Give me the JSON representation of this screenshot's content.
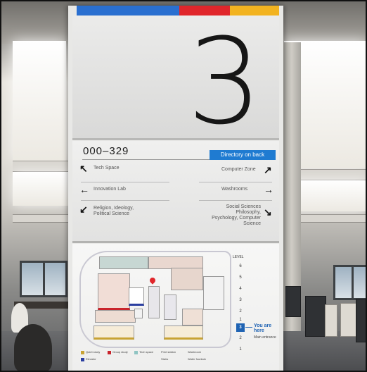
{
  "scene": {
    "description_colors": {
      "blue": "#2a6fd0",
      "red": "#e0262b",
      "yellow": "#f2b320"
    }
  },
  "sign": {
    "floor_number": "3",
    "room_range": "000–329",
    "directory_label": "Directory on back",
    "directions": [
      {
        "arrow": "↖",
        "side": "left",
        "label": "Tech Space"
      },
      {
        "arrow": "↗",
        "side": "right",
        "label": "Computer Zone"
      },
      {
        "arrow": "←",
        "side": "left",
        "label": "Innovation Lab"
      },
      {
        "arrow": "→",
        "side": "right",
        "label": "Washrooms"
      },
      {
        "arrow": "↙",
        "side": "left",
        "label": "Religion, Ideology, Political Science"
      },
      {
        "arrow": "↘",
        "side": "right",
        "label": "Social Sciences Philosophy, Psychology, Computer Science"
      }
    ],
    "map": {
      "level_title": "LEVEL",
      "levels": [
        "6",
        "5",
        "4",
        "3",
        "2",
        "1",
        "3",
        "2",
        "1"
      ],
      "current_level": "3",
      "you_are_here": "You are here",
      "main_entrance": "Main entrance",
      "legend": [
        {
          "color": "#c8a334",
          "label": "Quiet study"
        },
        {
          "color": "#c9242c",
          "label": "Group study"
        },
        {
          "color": "#8fc4c2",
          "label": "Tech space"
        },
        {
          "color": "#2b3ea0",
          "label": "Washroom"
        },
        {
          "label": "Elevator"
        },
        {
          "label": "Stairs"
        },
        {
          "label": "Print station"
        },
        {
          "label": "Water fountain"
        }
      ]
    }
  }
}
